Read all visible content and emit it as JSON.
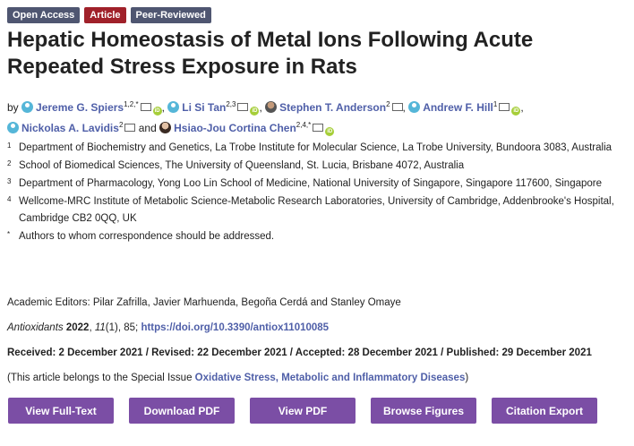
{
  "badges": [
    "Open Access",
    "Article",
    "Peer-Reviewed"
  ],
  "title": "Hepatic Homeostasis of Metal Ions Following Acute Repeated Stress Exposure in Rats",
  "by_label": "by",
  "and_label": "and",
  "authors": [
    {
      "name": "Jereme G. Spiers",
      "sup": "1,2,*",
      "avatar": "generic-avatar-icon"
    },
    {
      "name": "Li Si Tan",
      "sup": "2,3",
      "avatar": "generic-avatar-icon"
    },
    {
      "name": "Stephen T. Anderson",
      "sup": "2",
      "avatar": "photo"
    },
    {
      "name": "Andrew F. Hill",
      "sup": "1",
      "avatar": "generic-avatar-icon"
    },
    {
      "name": "Nickolas A. Lavidis",
      "sup": "2",
      "avatar": "generic-avatar-icon"
    },
    {
      "name": "Hsiao-Jou Cortina Chen",
      "sup": "2,4,*",
      "avatar": "photo"
    }
  ],
  "affiliations": [
    {
      "num": "1",
      "text": "Department of Biochemistry and Genetics, La Trobe Institute for Molecular Science, La Trobe University, Bundoora 3083, Australia"
    },
    {
      "num": "2",
      "text": "School of Biomedical Sciences, The University of Queensland, St. Lucia, Brisbane 4072, Australia"
    },
    {
      "num": "3",
      "text": "Department of Pharmacology, Yong Loo Lin School of Medicine, National University of Singapore, Singapore 117600, Singapore"
    },
    {
      "num": "4",
      "text": "Wellcome-MRC Institute of Metabolic Science-Metabolic Research Laboratories, University of Cambridge, Addenbrooke's Hospital, Cambridge CB2 0QQ, UK"
    },
    {
      "num": "*",
      "text": "Authors to whom correspondence should be addressed."
    }
  ],
  "editors": "Academic Editors: Pilar Zafrilla, Javier Marhuenda, Begoña Cerdá and Stanley Omaye",
  "citation": {
    "journal": "Antioxidants",
    "year": "2022",
    "volume": "11",
    "rest": "(1), 85; ",
    "doi": "https://doi.org/10.3390/antiox11010085"
  },
  "dates": "Received: 2 December 2021 / Revised: 22 December 2021 / Accepted: 28 December 2021 / Published: 29 December 2021",
  "special_issue": {
    "prefix": "(This article belongs to the Special Issue ",
    "link": "Oxidative Stress, Metabolic and Inflammatory Diseases",
    "suffix": ")"
  },
  "buttons": [
    "View Full-Text",
    "Download PDF",
    "View PDF",
    "Browse Figures",
    "Citation Export"
  ],
  "colors": {
    "accent": "#7b4ea5",
    "link": "#4f5fa8",
    "article_badge": "#a0212a",
    "badge": "#4f5671"
  }
}
